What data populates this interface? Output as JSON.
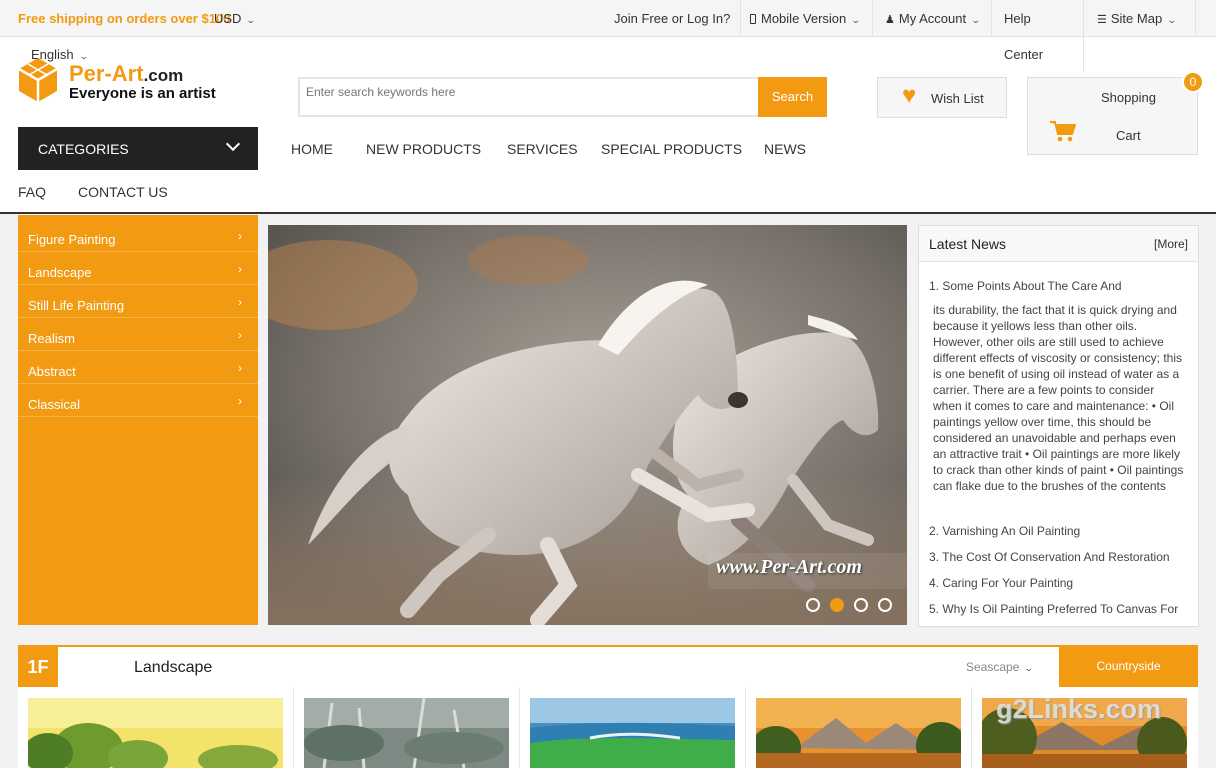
{
  "topbar": {
    "shipping": "Free shipping on orders over $100",
    "currency": "USD",
    "join": "Join Free or Log In?",
    "mobile": "Mobile Version",
    "account": "My Account",
    "help_line1": "Help",
    "help_line2": "Center",
    "sitemap": "Site Map"
  },
  "header": {
    "language": "English",
    "logo_main": "Per-Art",
    "logo_suffix": ".com",
    "logo_tagline": "Everyone is an artist",
    "search_placeholder": "Enter search keywords here",
    "search_button": "Search",
    "wishlist": "Wish List",
    "cart_line1": "Shopping",
    "cart_line2": "Cart",
    "cart_count": "0"
  },
  "nav": {
    "categories": "CATEGORIES",
    "items": [
      "HOME",
      "NEW PRODUCTS",
      "SERVICES",
      "SPECIAL PRODUCTS",
      "NEWS"
    ],
    "items2": [
      "FAQ",
      "CONTACT US"
    ]
  },
  "menu": [
    {
      "label": "Figure Painting"
    },
    {
      "label": "Landscape"
    },
    {
      "label": "Still Life Painting"
    },
    {
      "label": "Realism"
    },
    {
      "label": "Abstract"
    },
    {
      "label": "Classical"
    }
  ],
  "banner": {
    "watermark": "www.Per-Art.com",
    "active_slide": 2,
    "slides": 4
  },
  "news": {
    "title": "Latest News",
    "more": "[More]",
    "items": [
      "1. Some Points About The Care And",
      "2. Varnishing An Oil Painting",
      "3. The Cost Of Conservation And Restoration",
      "4. Caring For Your Painting",
      "5. Why Is Oil Painting Preferred To Canvas For"
    ],
    "body": "its durability, the fact that it is quick drying and because it yellows less than other oils. However, other oils are still used to achieve different effects of viscosity or consistency; this is one benefit of using oil instead of water as a carrier. There are a few points to consider when it comes to care and maintenance: • Oil paintings yellow over time, this should be considered an unavoidable and perhaps even an attractive trait • Oil paintings are more likely to crack than other kinds of paint • Oil paintings can flake due to the brushes of the contents"
  },
  "floor": {
    "number": "1F",
    "title": "Landscape",
    "tab_seascape": "Seascape",
    "tab_countryside": "Countryside"
  },
  "watermark2": "g2Links.com",
  "colors": {
    "accent": "#f19a12",
    "dark": "#222222"
  }
}
